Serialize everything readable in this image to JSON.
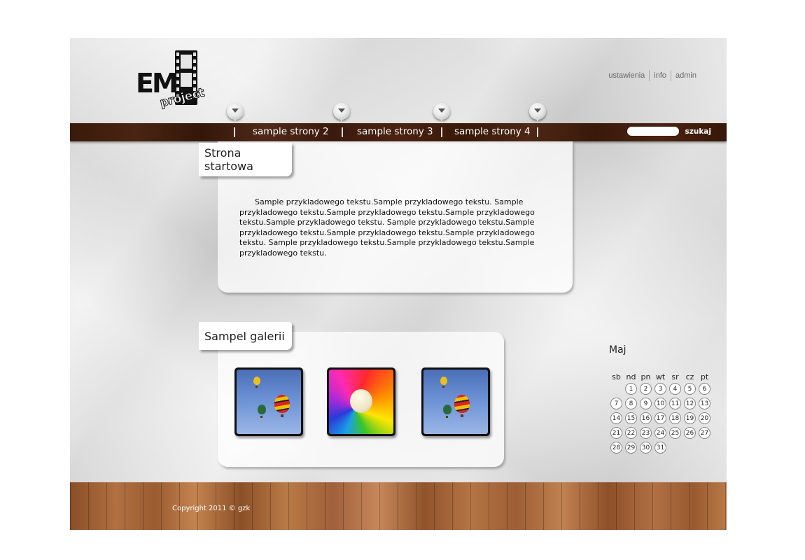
{
  "logo": {
    "letters": "EM",
    "sub": "project"
  },
  "top_links": [
    "ustawienia",
    "info",
    "admin"
  ],
  "nav": {
    "items": [
      {
        "label": "sample strony 2"
      },
      {
        "label": "sample strony 3"
      },
      {
        "label": "sample strony 4"
      }
    ],
    "search": {
      "button_label": "szukaj",
      "value": ""
    }
  },
  "main": {
    "title": "Strona startowa",
    "text": "Sample przykladowego tekstu.Sample przykladowego tekstu. Sample przykladowego tekstu.Sample przykladowego tekstu.Sample przykladowego tekstu.Sample przykladowego tekstu. Sample przykladowego tekstu.Sample przykladowego tekstu.Sample przykladowego tekstu.Sample przykladowego tekstu. Sample przykladowego tekstu.Sample przykladowego tekstu.Sample przykladowego tekstu."
  },
  "gallery": {
    "title": "Sampel galerii",
    "images": [
      "balloons-photo",
      "rainbow-swirl-photo",
      "balloons-photo"
    ]
  },
  "calendar": {
    "month": "Maj",
    "day_headers": [
      "sb",
      "nd",
      "pn",
      "wt",
      "sr",
      "cz",
      "pt"
    ],
    "weeks": [
      [
        "",
        "1",
        "2",
        "3",
        "4",
        "5",
        "6"
      ],
      [
        "7",
        "8",
        "9",
        "10",
        "11",
        "12",
        "13"
      ],
      [
        "14",
        "15",
        "16",
        "17",
        "18",
        "19",
        "20"
      ],
      [
        "21",
        "22",
        "23",
        "24",
        "25",
        "26",
        "27"
      ],
      [
        "28",
        "29",
        "30",
        "31",
        "",
        "",
        ""
      ]
    ]
  },
  "footer": {
    "copyright": "Copyright 2011 © gzk"
  },
  "colors": {
    "nav_bar": "#3f1d0c",
    "paper": "#e2e2e2",
    "wood": "#a86a3c"
  }
}
